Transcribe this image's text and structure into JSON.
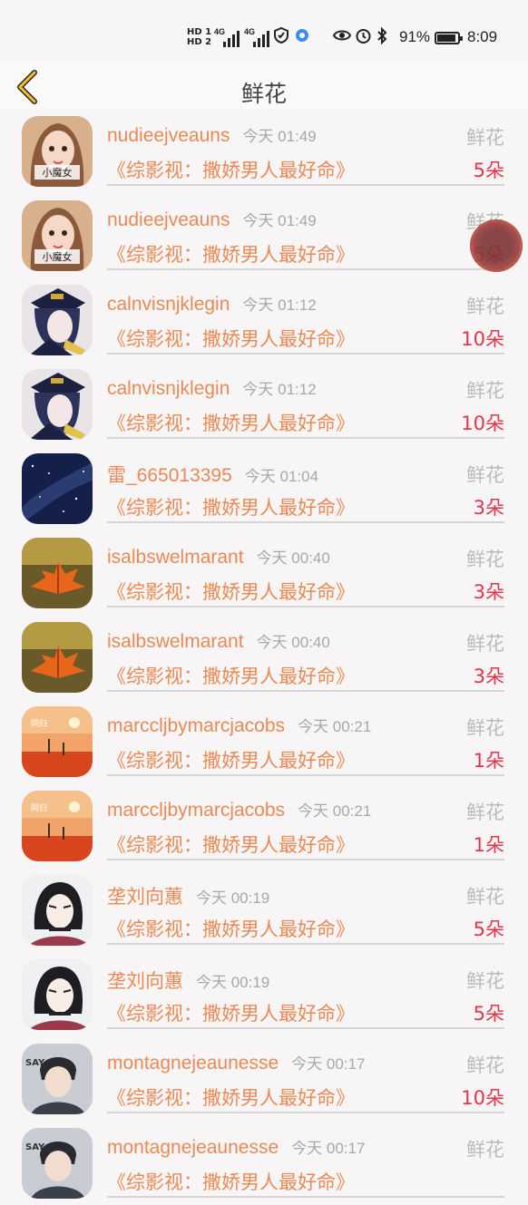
{
  "status_bar": {
    "network_top": "HD 1",
    "network_bottom": "HD 2",
    "sig1": "4G",
    "sig2": "4G",
    "battery": "91%",
    "battery_level": 0.91,
    "time": "8:09"
  },
  "header": {
    "title": "鲜花"
  },
  "rows": [
    {
      "name": "nudieejveauns",
      "time": "今天 01:49",
      "book": "《综影视：撒娇男人最好命》",
      "gift": "鲜花",
      "count": "5朵",
      "avatar": "girl"
    },
    {
      "name": "nudieejveauns",
      "time": "今天 01:49",
      "book": "《综影视：撒娇男人最好命》",
      "gift": "鲜花",
      "count": "5朵",
      "avatar": "girl"
    },
    {
      "name": "calnvisnjklegin",
      "time": "今天 01:12",
      "book": "《综影视：撒娇男人最好命》",
      "gift": "鲜花",
      "count": "10朵",
      "avatar": "anime-officer"
    },
    {
      "name": "calnvisnjklegin",
      "time": "今天 01:12",
      "book": "《综影视：撒娇男人最好命》",
      "gift": "鲜花",
      "count": "10朵",
      "avatar": "anime-officer"
    },
    {
      "name": "雷_665013395",
      "time": "今天 01:04",
      "book": "《综影视：撒娇男人最好命》",
      "gift": "鲜花",
      "count": "3朵",
      "avatar": "galaxy"
    },
    {
      "name": "isalbswelmarant",
      "time": "今天 00:40",
      "book": "《综影视：撒娇男人最好命》",
      "gift": "鲜花",
      "count": "3朵",
      "avatar": "leaf"
    },
    {
      "name": "isalbswelmarant",
      "time": "今天 00:40",
      "book": "《综影视：撒娇男人最好命》",
      "gift": "鲜花",
      "count": "3朵",
      "avatar": "leaf"
    },
    {
      "name": "marccljbymarcjacobs",
      "time": "今天 00:21",
      "book": "《综影视：撒娇男人最好命》",
      "gift": "鲜花",
      "count": "1朵",
      "avatar": "sunset"
    },
    {
      "name": "marccljbymarcjacobs",
      "time": "今天 00:21",
      "book": "《综影视：撒娇男人最好命》",
      "gift": "鲜花",
      "count": "1朵",
      "avatar": "sunset"
    },
    {
      "name": "垄刘向蕙",
      "time": "今天 00:19",
      "book": "《综影视：撒娇男人最好命》",
      "gift": "鲜花",
      "count": "5朵",
      "avatar": "anime-woman"
    },
    {
      "name": "垄刘向蕙",
      "time": "今天 00:19",
      "book": "《综影视：撒娇男人最好命》",
      "gift": "鲜花",
      "count": "5朵",
      "avatar": "anime-woman"
    },
    {
      "name": "montagnejeaunesse",
      "time": "今天 00:17",
      "book": "《综影视：撒娇男人最好命》",
      "gift": "鲜花",
      "count": "10朵",
      "avatar": "boy"
    },
    {
      "name": "montagnejeaunesse",
      "time": "今天 00:17",
      "book": "《综影视：撒娇男人最好命》",
      "gift": "鲜花",
      "count": "",
      "avatar": "boy"
    }
  ],
  "avatar_label_girl": "小魔女",
  "avatar_label_sunset": "同归",
  "avatar_label_boy": "SAY",
  "colors": {
    "accent": "#e98a55",
    "count": "#e4344a",
    "back_arrow": "#f2c21b"
  }
}
